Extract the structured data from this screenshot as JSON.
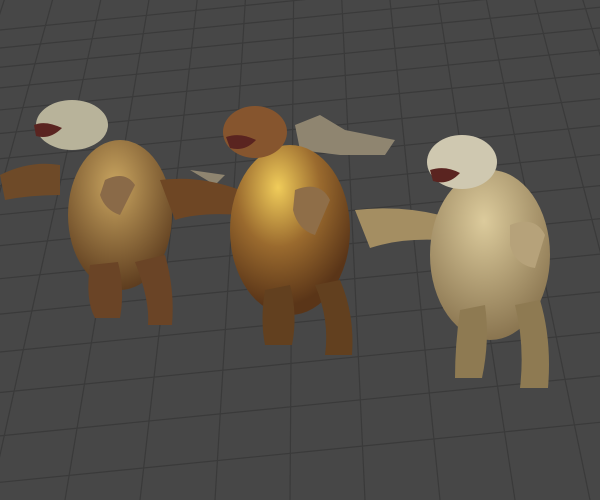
{
  "viewport": {
    "background_color": "#474747",
    "grid_color": "#3a3a3a",
    "models": [
      {
        "name": "bear-brown",
        "fur_color": "#7a5430",
        "highlight_color": "#c9a560",
        "head_color": "#b8b39a"
      },
      {
        "name": "bear-spiked",
        "fur_color": "#7c5028",
        "highlight_color": "#e2b94e",
        "head_color": "#8a5a34"
      },
      {
        "name": "bear-pale",
        "fur_color": "#b49c6c",
        "highlight_color": "#d8c79a",
        "head_color": "#cfc8b0"
      }
    ]
  }
}
